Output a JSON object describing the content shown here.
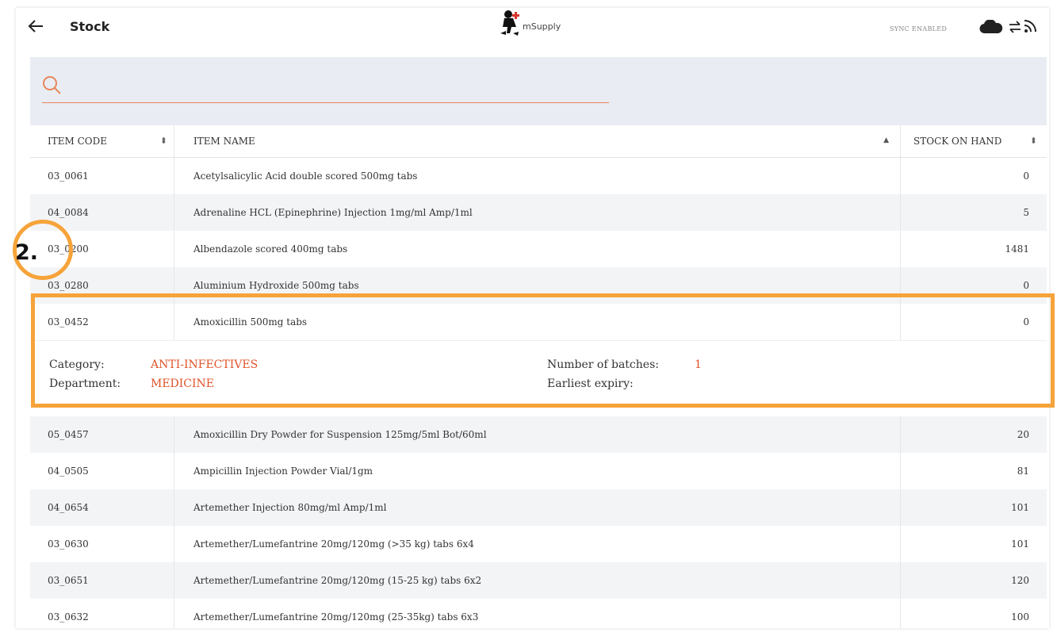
{
  "header": {
    "title": "Stock",
    "logo_text": "mSupply",
    "sync_status": "SYNC ENABLED"
  },
  "search": {
    "placeholder": "",
    "value": ""
  },
  "table": {
    "columns": [
      {
        "label": "ITEM CODE",
        "sort_icon": "sort-both-icon"
      },
      {
        "label": "ITEM NAME",
        "sort_icon": "sort-ascending-icon"
      },
      {
        "label": "STOCK ON HAND",
        "sort_icon": "sort-both-icon"
      }
    ],
    "rows_before": [
      {
        "code": "03_0061",
        "name": "Acetylsalicylic Acid double scored 500mg tabs",
        "stock": "0"
      },
      {
        "code": "04_0084",
        "name": "Adrenaline HCL (Epinephrine) Injection 1mg/ml Amp/1ml",
        "stock": "5"
      },
      {
        "code": "03_0200",
        "name": "Albendazole scored 400mg tabs",
        "stock": "1481"
      },
      {
        "code": "03_0280",
        "name": "Aluminium Hydroxide 500mg tabs",
        "stock": "0"
      },
      {
        "code": "03_0452",
        "name": "Amoxicillin 500mg tabs",
        "stock": "0"
      }
    ],
    "expanded_details": {
      "category_label": "Category:",
      "category_value": "ANTI-INFECTIVES",
      "department_label": "Department:",
      "department_value": "MEDICINE",
      "batches_label": "Number of batches:",
      "batches_value": "1",
      "expiry_label": "Earliest expiry:",
      "expiry_value": ""
    },
    "rows_after": [
      {
        "code": "05_0457",
        "name": "Amoxicillin Dry Powder for Suspension 125mg/5ml Bot/60ml",
        "stock": "20"
      },
      {
        "code": "04_0505",
        "name": "Ampicillin Injection Powder Vial/1gm",
        "stock": "81"
      },
      {
        "code": "04_0654",
        "name": "Artemether Injection 80mg/ml Amp/1ml",
        "stock": "101"
      },
      {
        "code": "03_0630",
        "name": "Artemether/Lumefantrine 20mg/120mg (>35 kg) tabs 6x4",
        "stock": "101"
      },
      {
        "code": "03_0651",
        "name": "Artemether/Lumefantrine 20mg/120mg (15-25 kg) tabs 6x2",
        "stock": "120"
      },
      {
        "code": "03_0632",
        "name": "Artemether/Lumefantrine 20mg/120mg (25-35kg) tabs 6x3",
        "stock": "100"
      }
    ]
  },
  "annotation": {
    "step_number": "2."
  },
  "colors": {
    "accent": "#e0542b",
    "highlight": "#f6a33a",
    "search_underline": "#e8855a"
  }
}
